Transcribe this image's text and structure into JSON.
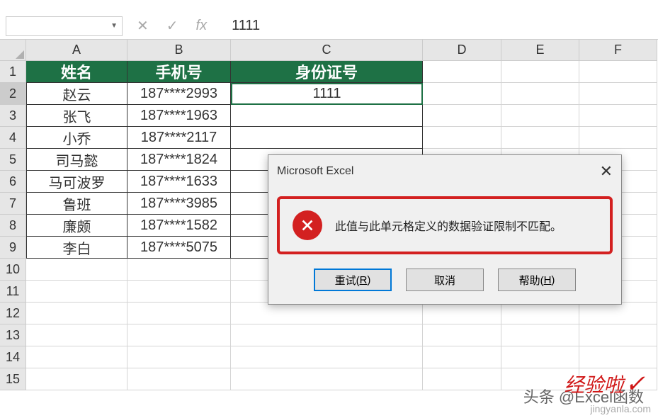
{
  "formula_bar": {
    "value": "1111"
  },
  "columns": [
    "A",
    "B",
    "C",
    "D",
    "E",
    "F"
  ],
  "rows": [
    1,
    2,
    3,
    4,
    5,
    6,
    7,
    8,
    9,
    10,
    11,
    12,
    13,
    14,
    15
  ],
  "headers": {
    "A": "姓名",
    "B": "手机号",
    "C": "身份证号"
  },
  "data": [
    {
      "name": "赵云",
      "phone": "187****2993",
      "id": "1111"
    },
    {
      "name": "张飞",
      "phone": "187****1963",
      "id": ""
    },
    {
      "name": "小乔",
      "phone": "187****2117",
      "id": ""
    },
    {
      "name": "司马懿",
      "phone": "187****1824",
      "id": ""
    },
    {
      "name": "马可波罗",
      "phone": "187****1633",
      "id": ""
    },
    {
      "name": "鲁班",
      "phone": "187****3985",
      "id": ""
    },
    {
      "name": "廉颇",
      "phone": "187****1582",
      "id": ""
    },
    {
      "name": "李白",
      "phone": "187****5075",
      "id": ""
    }
  ],
  "dialog": {
    "title": "Microsoft Excel",
    "message": "此值与此单元格定义的数据验证限制不匹配。",
    "retry": "重试(R)",
    "cancel": "取消",
    "help": "帮助(H)"
  },
  "watermark": {
    "text1": "头条 @Excel函数",
    "text2": "经验啦",
    "small": "jingyanla.com"
  },
  "chart_data": {
    "type": "table",
    "title": "",
    "columns": [
      "姓名",
      "手机号",
      "身份证号"
    ],
    "rows": [
      [
        "赵云",
        "187****2993",
        "1111"
      ],
      [
        "张飞",
        "187****1963",
        ""
      ],
      [
        "小乔",
        "187****2117",
        ""
      ],
      [
        "司马懿",
        "187****1824",
        ""
      ],
      [
        "马可波罗",
        "187****1633",
        ""
      ],
      [
        "鲁班",
        "187****3985",
        ""
      ],
      [
        "廉颇",
        "187****1582",
        ""
      ],
      [
        "李白",
        "187****5075",
        ""
      ]
    ]
  }
}
